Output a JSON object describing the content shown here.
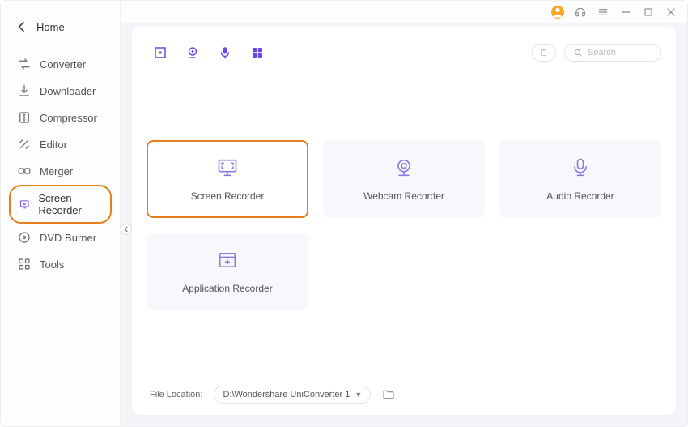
{
  "sidebar": {
    "home_label": "Home",
    "items": [
      {
        "label": "Converter",
        "icon": "converter"
      },
      {
        "label": "Downloader",
        "icon": "downloader"
      },
      {
        "label": "Compressor",
        "icon": "compressor"
      },
      {
        "label": "Editor",
        "icon": "editor"
      },
      {
        "label": "Merger",
        "icon": "merger"
      },
      {
        "label": "Screen Recorder",
        "icon": "screen-recorder",
        "selected": true
      },
      {
        "label": "DVD Burner",
        "icon": "dvd-burner"
      },
      {
        "label": "Tools",
        "icon": "tools"
      }
    ]
  },
  "toolbar": {
    "search_placeholder": "Search"
  },
  "cards": [
    {
      "label": "Screen Recorder",
      "highlight": true
    },
    {
      "label": "Webcam Recorder"
    },
    {
      "label": "Audio Recorder"
    },
    {
      "label": "Application Recorder"
    }
  ],
  "footer": {
    "location_label": "File Location:",
    "path_value": "D:\\Wondershare UniConverter 1"
  },
  "colors": {
    "accent": "#6b46e6",
    "highlight_border": "#e57f1a"
  }
}
